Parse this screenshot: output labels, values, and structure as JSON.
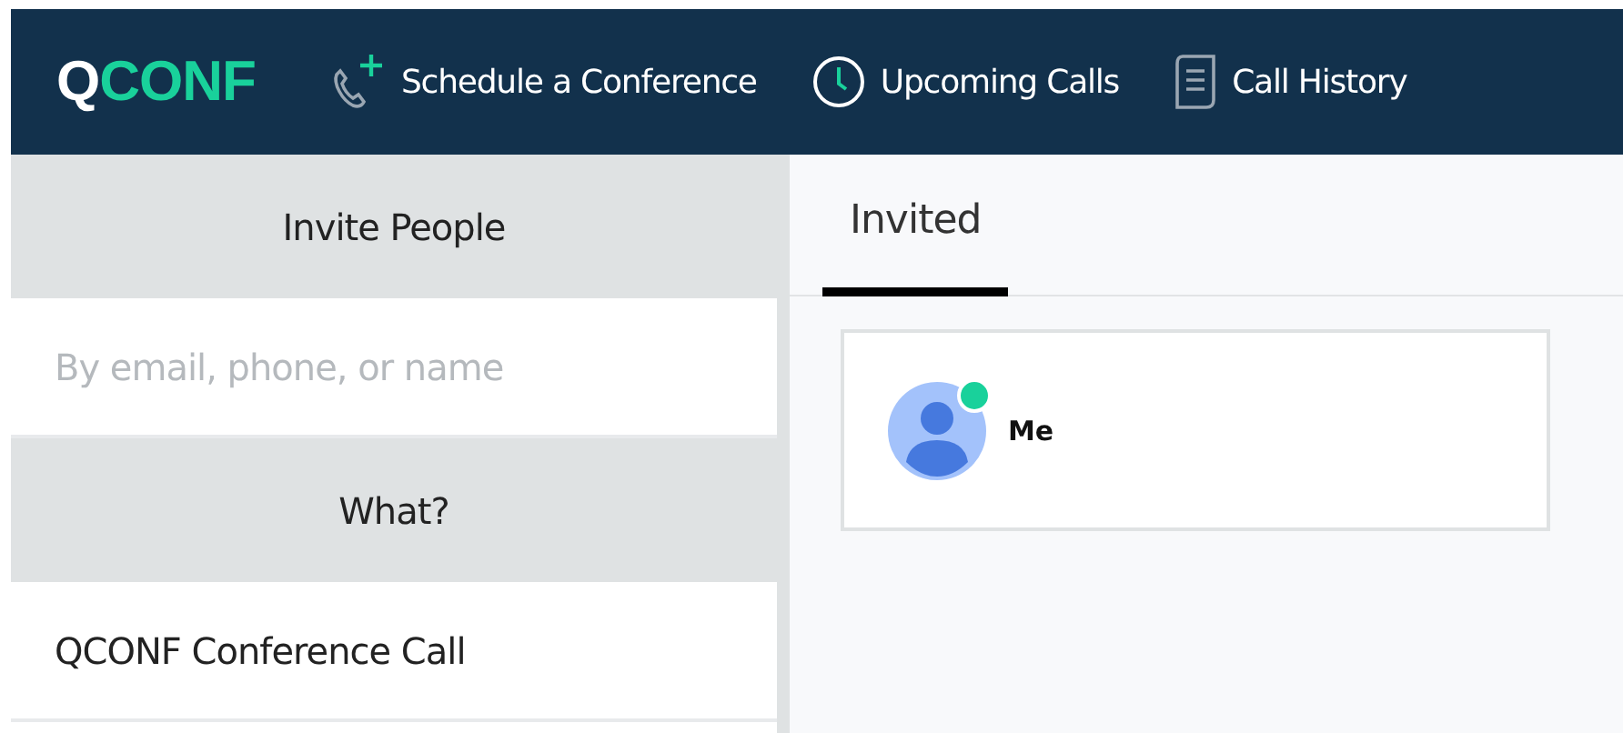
{
  "logo": {
    "accent": "Q",
    "text": "CONF"
  },
  "nav": [
    {
      "kind": "phone",
      "label": "Schedule a Conference"
    },
    {
      "kind": "clock",
      "label": "Upcoming Calls"
    },
    {
      "kind": "document",
      "label": "Call History"
    }
  ],
  "form": [
    {
      "heading": "Invite People",
      "placeholder": "By email, phone, or name"
    },
    {
      "heading": "What?",
      "value": "QCONF Conference Call"
    }
  ],
  "tabs": [
    {
      "label": "Invited",
      "selected": true
    }
  ],
  "participants": [
    {
      "name": "Me",
      "online": true
    }
  ]
}
